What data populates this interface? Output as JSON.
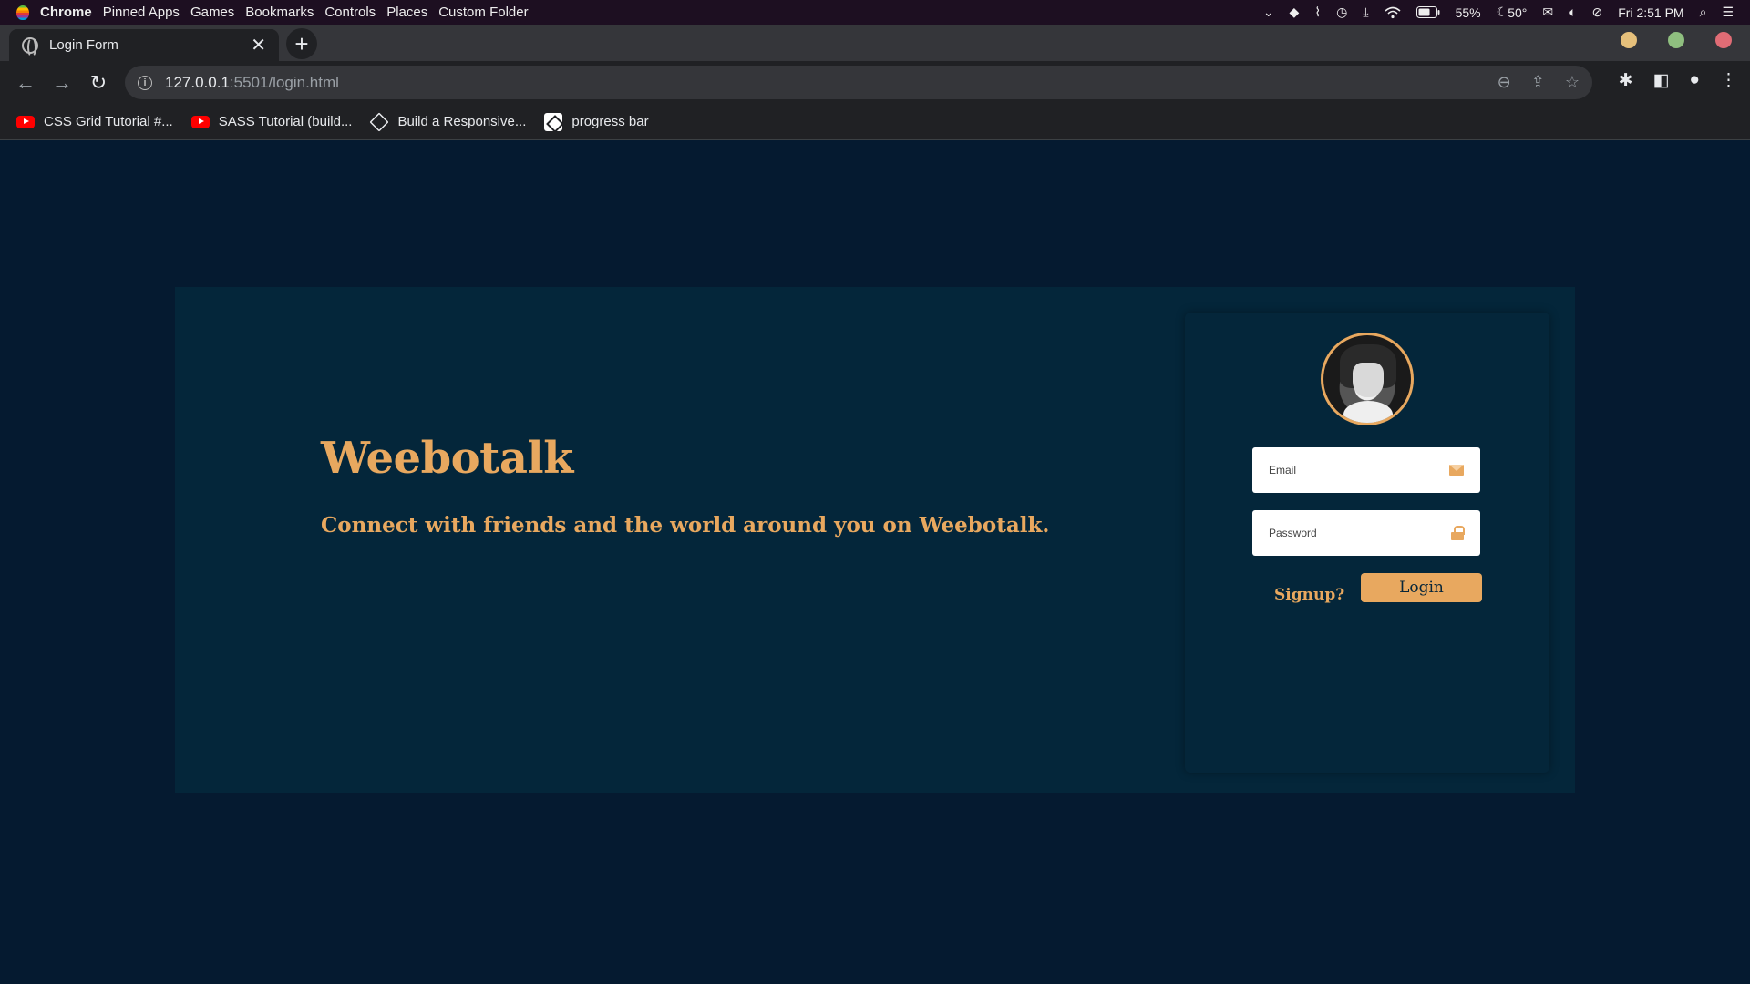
{
  "menubar": {
    "app": "Chrome",
    "items": [
      "Pinned Apps",
      "Games",
      "Bookmarks",
      "Controls",
      "Places",
      "Custom Folder"
    ],
    "battery": "55%",
    "weather": "50°",
    "clock": "Fri 2:51 PM"
  },
  "tab": {
    "title": "Login Form",
    "close": "✕",
    "new": "+"
  },
  "window_controls": {
    "minimize": "#e6c07b",
    "maximize": "#8fbf7f",
    "close": "#e06c75"
  },
  "toolbar": {
    "back": "←",
    "forward": "→",
    "reload": "↻",
    "url_host": "127.0.0.1",
    "url_path": ":5501/login.html"
  },
  "bookmarks": [
    {
      "label": "CSS Grid Tutorial #...",
      "icon": "youtube-icon"
    },
    {
      "label": "SASS Tutorial (build...",
      "icon": "youtube-icon"
    },
    {
      "label": "Build a Responsive...",
      "icon": "codepen-icon"
    },
    {
      "label": "progress bar",
      "icon": "codepen-icon"
    }
  ],
  "page": {
    "brand": "Weebotalk",
    "tagline": "Connect with friends and the world around you on Weebotalk.",
    "email_placeholder": "Email",
    "password_placeholder": "Password",
    "signup": "Signup?",
    "login": "Login",
    "accent": "#e8a85f",
    "background": "#051a30",
    "card": "#04263a"
  }
}
